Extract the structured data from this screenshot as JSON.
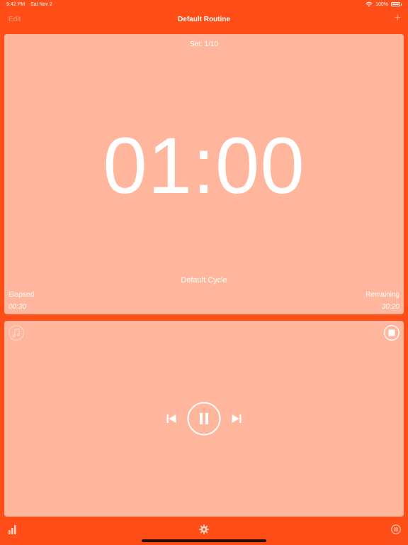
{
  "status_bar": {
    "time": "9:42 PM",
    "date": "Sat Nov 2",
    "battery": "100%",
    "icons": [
      "wifi-icon",
      "battery-icon"
    ]
  },
  "nav": {
    "edit_label": "Edit",
    "title": "Default Routine",
    "add_label": "+"
  },
  "timer": {
    "set_label": "Set: 1/10",
    "time": "01:00",
    "cycle_name": "Default Cycle",
    "elapsed_label": "Elapsed",
    "elapsed_value": "00:30",
    "remaining_label": "Remaining",
    "remaining_value": "30:20"
  },
  "player": {
    "icons": [
      "music-icon",
      "stop-icon",
      "previous-icon",
      "pause-icon",
      "next-icon"
    ]
  },
  "tab_bar": {
    "icons": [
      "stats-icon",
      "settings-icon",
      "menu-icon"
    ]
  },
  "colors": {
    "background": "#FF4E17",
    "panel": "#FFB69D",
    "text": "#FFFFFF"
  }
}
